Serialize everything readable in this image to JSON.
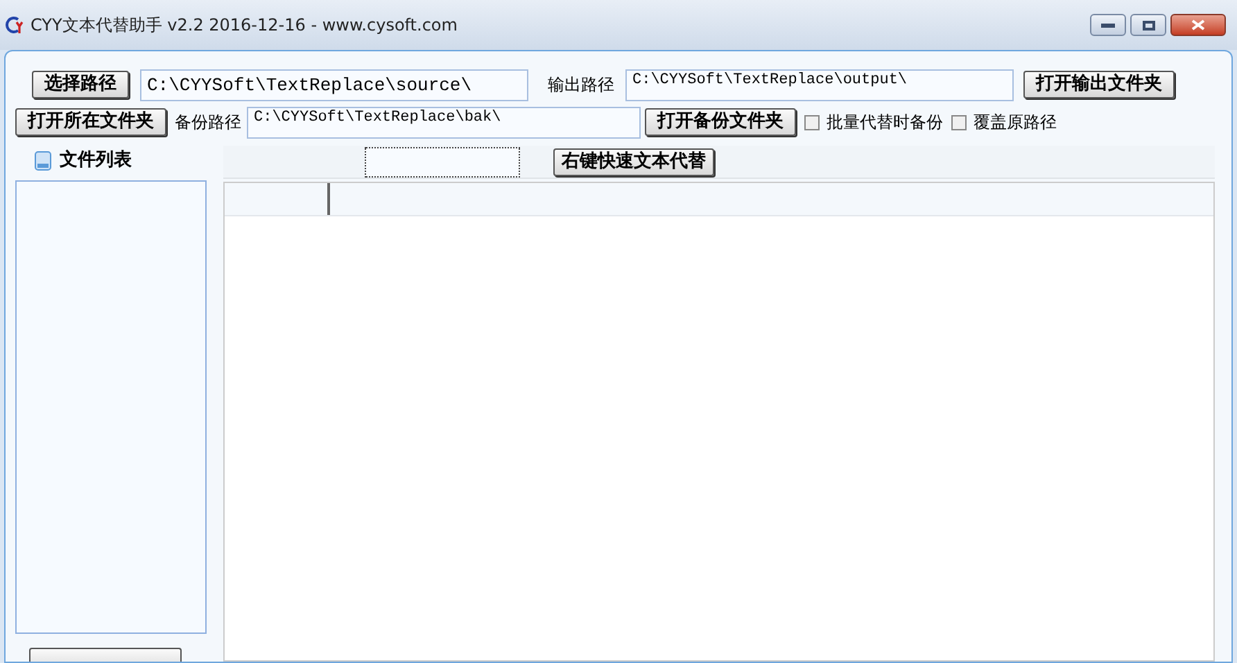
{
  "window": {
    "title": "CYY文本代替助手 v2.2 2016-12-16 - www.cysoft.com"
  },
  "source": {
    "button": "选择路径",
    "value": "C:\\CYYSoft\\TextReplace\\source\\"
  },
  "output": {
    "label": "输出路径",
    "value": "C:\\CYYSoft\\TextReplace\\output\\",
    "button": "打开输出文件夹"
  },
  "backup": {
    "open_button": "打开所在文件夹",
    "label": "备份路径",
    "value": "C:\\CYYSoft\\TextReplace\\bak\\",
    "button": "打开备份文件夹"
  },
  "options": [
    {
      "label": "批量代替时备份",
      "checked": false
    },
    {
      "label": "覆盖原路径",
      "checked": false
    }
  ],
  "file_list": {
    "title": "文件列表"
  },
  "toolbar": {
    "button": "右键快速文本代替"
  }
}
